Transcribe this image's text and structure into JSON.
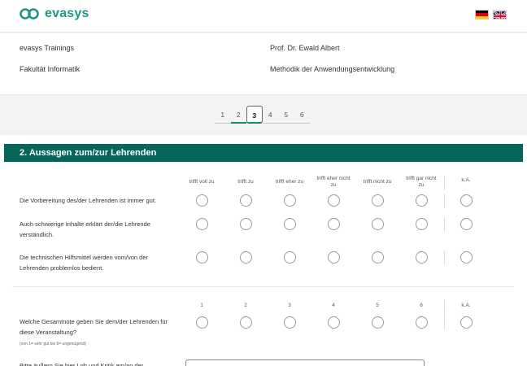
{
  "header": {
    "brand": "evasys",
    "brand_color": "#1f9583",
    "languages": [
      {
        "code": "de",
        "icon": "flag-germany-icon"
      },
      {
        "code": "en",
        "icon": "flag-uk-icon"
      }
    ]
  },
  "info": {
    "course_group": "evasys Trainings",
    "lecturer": "Prof. Dr. Ewald Albert",
    "faculty": "Fakultät Informatik",
    "course": "Methodik der Anwendungsentwicklung"
  },
  "pagination": {
    "pages": [
      "1",
      "2",
      "3",
      "4",
      "5",
      "6"
    ],
    "current": "3",
    "visited": [
      "2",
      "3"
    ]
  },
  "section": {
    "title": "2. Aussagen zum/zur Lehrenden",
    "title_bg": "#05665b",
    "scale_labels": [
      "trifft voll zu",
      "trifft zu",
      "trifft eher zu",
      "trifft eher nicht zu",
      "trifft nicht zu",
      "trifft gar nicht zu",
      "k.A."
    ],
    "questions": [
      {
        "text": "Die Vorbereitung des/der Lehrenden ist immer gut."
      },
      {
        "text": "Auch schwierige Inhalte erklärt der/die Lehrende verständlich."
      },
      {
        "text": "Die technischen Hilfsmittel werden vom/von der Lehrenden problemlos bedient."
      }
    ],
    "grade_labels": [
      "1",
      "2",
      "3",
      "4",
      "5",
      "6",
      "k.A."
    ],
    "grade_question": {
      "text": "Welche Gesamtnote geben Sie dem/der Lehrenden für diese Veranstaltung?",
      "subtext": "(von 1= sehr gut bis 6= ungenügend)"
    },
    "comment_prompt": "Bitte äußern Sie hier Lob und Kritik am/an der"
  }
}
